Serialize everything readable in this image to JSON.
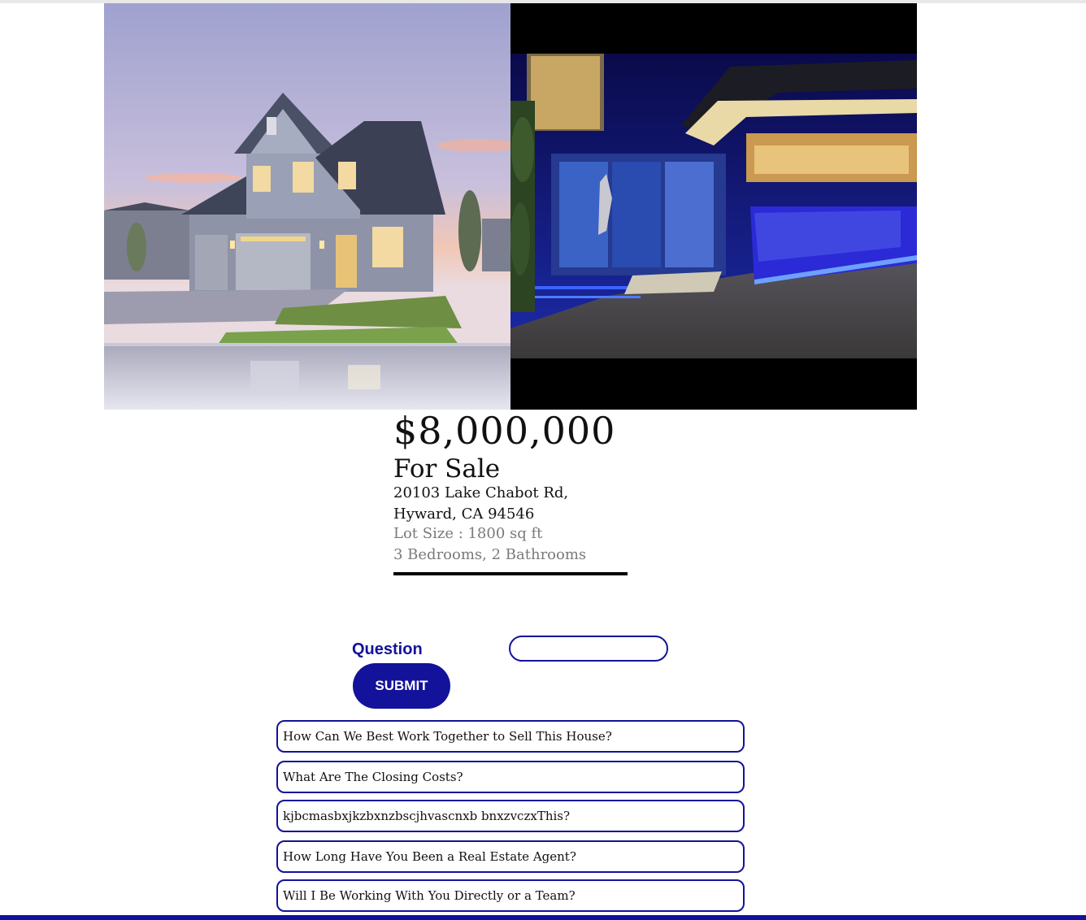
{
  "images": {
    "left_alt": "suburban-house-photo",
    "right_alt": "modern-luxury-house-photo"
  },
  "listing": {
    "price": "$8,000,000",
    "status": "For Sale",
    "address_line1": "20103 Lake Chabot Rd,",
    "address_line2": "Hyward, CA 94546",
    "lot_size": "Lot Size : 1800 sq ft",
    "rooms": "3 Bedrooms, 2 Bathrooms"
  },
  "form": {
    "question_label": "Question",
    "question_value": "",
    "question_placeholder": "",
    "submit_label": "SUBMIT"
  },
  "questions": [
    "How Can We Best Work Together to Sell This House?",
    "What Are The Closing Costs?",
    "kjbcmasbxjkzbxnzbscjhvascnxb bnxzvczxThis?",
    "How Long Have You Been a Real Estate Agent?",
    "Will I Be Working With You Directly or a Team?"
  ],
  "colors": {
    "accent": "#13129a",
    "text": "#111111",
    "muted": "#7a7a7a"
  }
}
